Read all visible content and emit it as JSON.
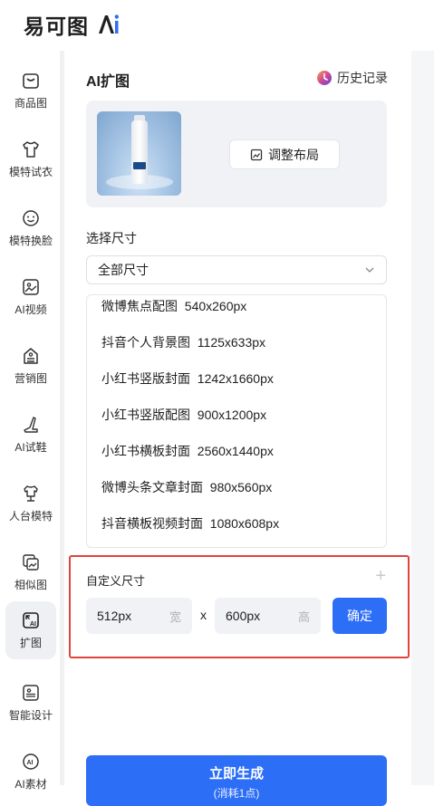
{
  "app": {
    "logo_text": "易可图",
    "logo_ai": "Ai"
  },
  "sidebar": {
    "items": [
      {
        "label": "商品图",
        "icon": "bag-icon"
      },
      {
        "label": "模特试衣",
        "icon": "tshirt-icon"
      },
      {
        "label": "模特换脸",
        "icon": "face-icon"
      },
      {
        "label": "AI视频",
        "icon": "video-icon"
      },
      {
        "label": "营销图",
        "icon": "marketing-icon"
      },
      {
        "label": "AI试鞋",
        "icon": "shoe-icon"
      },
      {
        "label": "人台模特",
        "icon": "mannequin-icon"
      },
      {
        "label": "相似图",
        "icon": "similar-image-icon"
      },
      {
        "label": "扩图",
        "icon": "expand-icon",
        "active": true
      },
      {
        "label": "智能设计",
        "icon": "smart-design-icon"
      },
      {
        "label": "AI素材",
        "icon": "ai-material-icon"
      }
    ]
  },
  "panel": {
    "title": "AI扩图",
    "history_label": "历史记录",
    "adjust_label": "调整布局",
    "size_section_label": "选择尺寸",
    "size_select_value": "全部尺寸",
    "size_options": [
      {
        "name": "微博焦点配图",
        "dims": "540x260px"
      },
      {
        "name": "抖音个人背景图",
        "dims": "1125x633px"
      },
      {
        "name": "小红书竖版封面",
        "dims": "1242x1660px"
      },
      {
        "name": "小红书竖版配图",
        "dims": "900x1200px"
      },
      {
        "name": "小红书横板封面",
        "dims": "2560x1440px"
      },
      {
        "name": "微博头条文章封面",
        "dims": "980x560px"
      },
      {
        "name": "抖音横板视频封面",
        "dims": "1080x608px"
      }
    ],
    "custom": {
      "title": "自定义尺寸",
      "plus": "+",
      "width_value": "512px",
      "width_suffix": "宽",
      "separator": "x",
      "height_value": "600px",
      "height_suffix": "高",
      "confirm_label": "确定"
    },
    "generate": {
      "label": "立即生成",
      "sub_label": "(消耗1点)"
    }
  },
  "colors": {
    "primary": "#2d6ef7",
    "highlight_border": "#e0443b",
    "card_bg": "#f1f2f5"
  }
}
